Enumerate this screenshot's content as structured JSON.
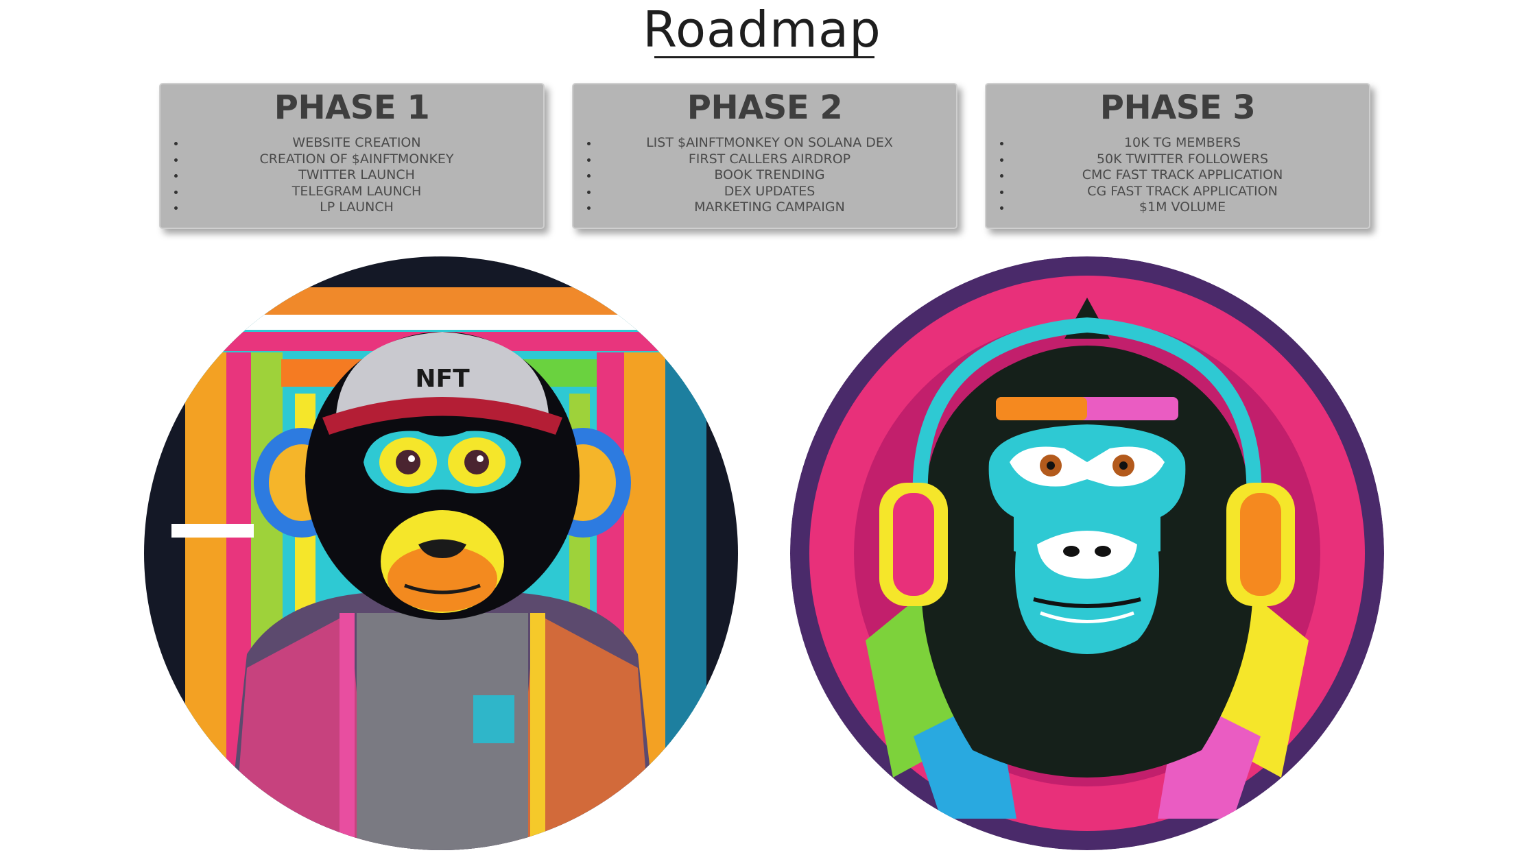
{
  "page": {
    "title": "Roadmap"
  },
  "phases": [
    {
      "title": "PHASE 1",
      "items": [
        "WEBSITE CREATION",
        "CREATION OF $AINFTMONKEY",
        "TWITTER LAUNCH",
        "TELEGRAM LAUNCH",
        "LP LAUNCH"
      ]
    },
    {
      "title": "PHASE 2",
      "items": [
        "LIST $AINFTMONKEY ON SOLANA DEX",
        "FIRST CALLERS AIRDROP",
        "BOOK TRENDING",
        "DEX UPDATES",
        "MARKETING CAMPAIGN"
      ]
    },
    {
      "title": "PHASE 3",
      "items": [
        "10K TG MEMBERS",
        "50K TWITTER FOLLOWERS",
        "CMC FAST TRACK APPLICATION",
        "CG FAST TRACK APPLICATION",
        "$1M VOLUME"
      ]
    }
  ],
  "images": {
    "left": {
      "icon": "monkey-with-nft-cap-icon",
      "cap_text": "NFT"
    },
    "right": {
      "icon": "monkey-with-headphones-icon"
    }
  },
  "colors": {
    "card_bg": "#b5b5b5",
    "card_text": "#3e3e3e",
    "title": "#1e1e1e",
    "accent_pink": "#e8307a",
    "accent_cyan": "#33d6e0",
    "accent_yellow": "#f5e62a",
    "accent_orange": "#f5891f"
  }
}
